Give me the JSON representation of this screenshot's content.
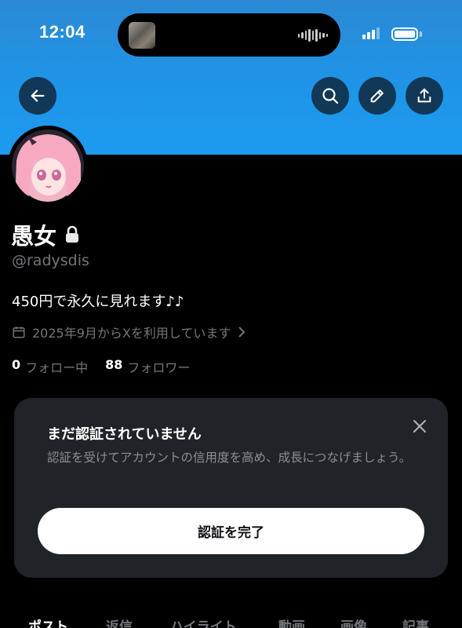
{
  "status_bar": {
    "time": "12:04"
  },
  "profile": {
    "name": "愚女",
    "handle": "@radysdis",
    "bio": "450円で永久に見れます♪♪",
    "joined": "2025年9月からXを利用しています",
    "following_count": "0",
    "following_label": "フォロー中",
    "followers_count": "88",
    "followers_label": "フォロワー"
  },
  "verify_card": {
    "title": "まだ認証されていません",
    "description": "認証を受けてアカウントの信用度を高め、成長につなげましょう。",
    "button_label": "認証を完了"
  },
  "tabs": [
    {
      "label": "ポスト"
    },
    {
      "label": "返信"
    },
    {
      "label": "ハイライト"
    },
    {
      "label": "動画"
    },
    {
      "label": "画像"
    },
    {
      "label": "記事"
    }
  ],
  "icons": {
    "back": "arrow-left-icon",
    "search": "search-icon",
    "edit": "pencil-icon",
    "share": "share-icon",
    "lock": "lock-icon",
    "calendar": "calendar-icon",
    "close": "close-icon"
  },
  "colors": {
    "banner": "#1d9bf0",
    "background": "#000000",
    "card": "#202327",
    "muted_text": "#71767b"
  }
}
